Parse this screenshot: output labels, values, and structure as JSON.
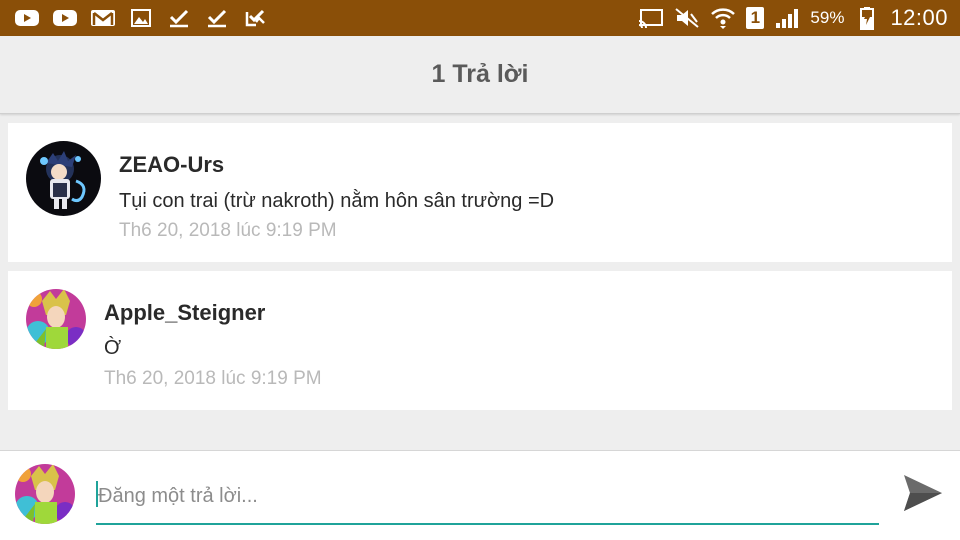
{
  "status_bar": {
    "notification_icons": [
      "youtube-icon",
      "youtube-icon",
      "gmail-icon",
      "image-icon",
      "check-icon",
      "check-icon",
      "check-list-icon"
    ],
    "system_icons": [
      "cast-icon",
      "mute-icon",
      "wifi-icon",
      "sim-icon",
      "signal-icon",
      "battery-icon"
    ],
    "sim_label": "1",
    "battery_percent": "59%",
    "time": "12:00",
    "background_color": "#8a4f08"
  },
  "app_bar": {
    "title": "1 Trả lời"
  },
  "comments": [
    {
      "author": "ZEAO-Urs",
      "text": "Tụi con trai (trừ nakroth) nằm hôn sân trường =D",
      "timestamp": "Th6 20, 2018 lúc 9:19 PM"
    },
    {
      "author": "Apple_Steigner",
      "text": "Ờ",
      "timestamp": "Th6 20, 2018 lúc 9:19 PM"
    }
  ],
  "reply": {
    "placeholder": "Đăng một trả lời...",
    "value": "",
    "accent_color": "#1fa39a",
    "send_icon": "send-icon"
  }
}
